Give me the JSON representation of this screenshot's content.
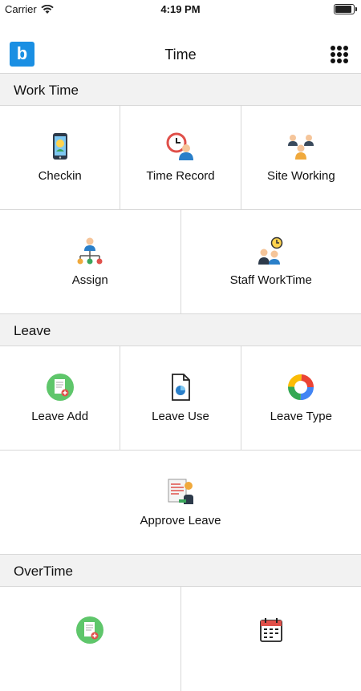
{
  "status": {
    "carrier": "Carrier",
    "time": "4:19 PM"
  },
  "header": {
    "logo": "b",
    "title": "Time"
  },
  "sections": {
    "work": "Work Time",
    "leave": "Leave",
    "overtime": "OverTime"
  },
  "work_items": [
    "Checkin",
    "Time Record",
    "Site Working",
    "Assign",
    "Staff WorkTime"
  ],
  "leave_items": [
    "Leave Add",
    "Leave Use",
    "Leave Type",
    "Approve Leave"
  ],
  "icons": {
    "checkin": "phone-location-icon",
    "time_record": "clock-person-icon",
    "site_working": "group-icon",
    "assign": "assign-person-icon",
    "staff_worktime": "staff-clock-icon",
    "leave_add": "document-add-icon",
    "leave_use": "document-chart-icon",
    "leave_type": "ring-chart-icon",
    "approve_leave": "approve-document-icon",
    "overtime_add": "document-add-icon",
    "overtime_calendar": "calendar-icon"
  },
  "colors": {
    "accent": "#1a8fe3",
    "divider": "#d8d8d8",
    "section_bg": "#f2f2f2"
  }
}
